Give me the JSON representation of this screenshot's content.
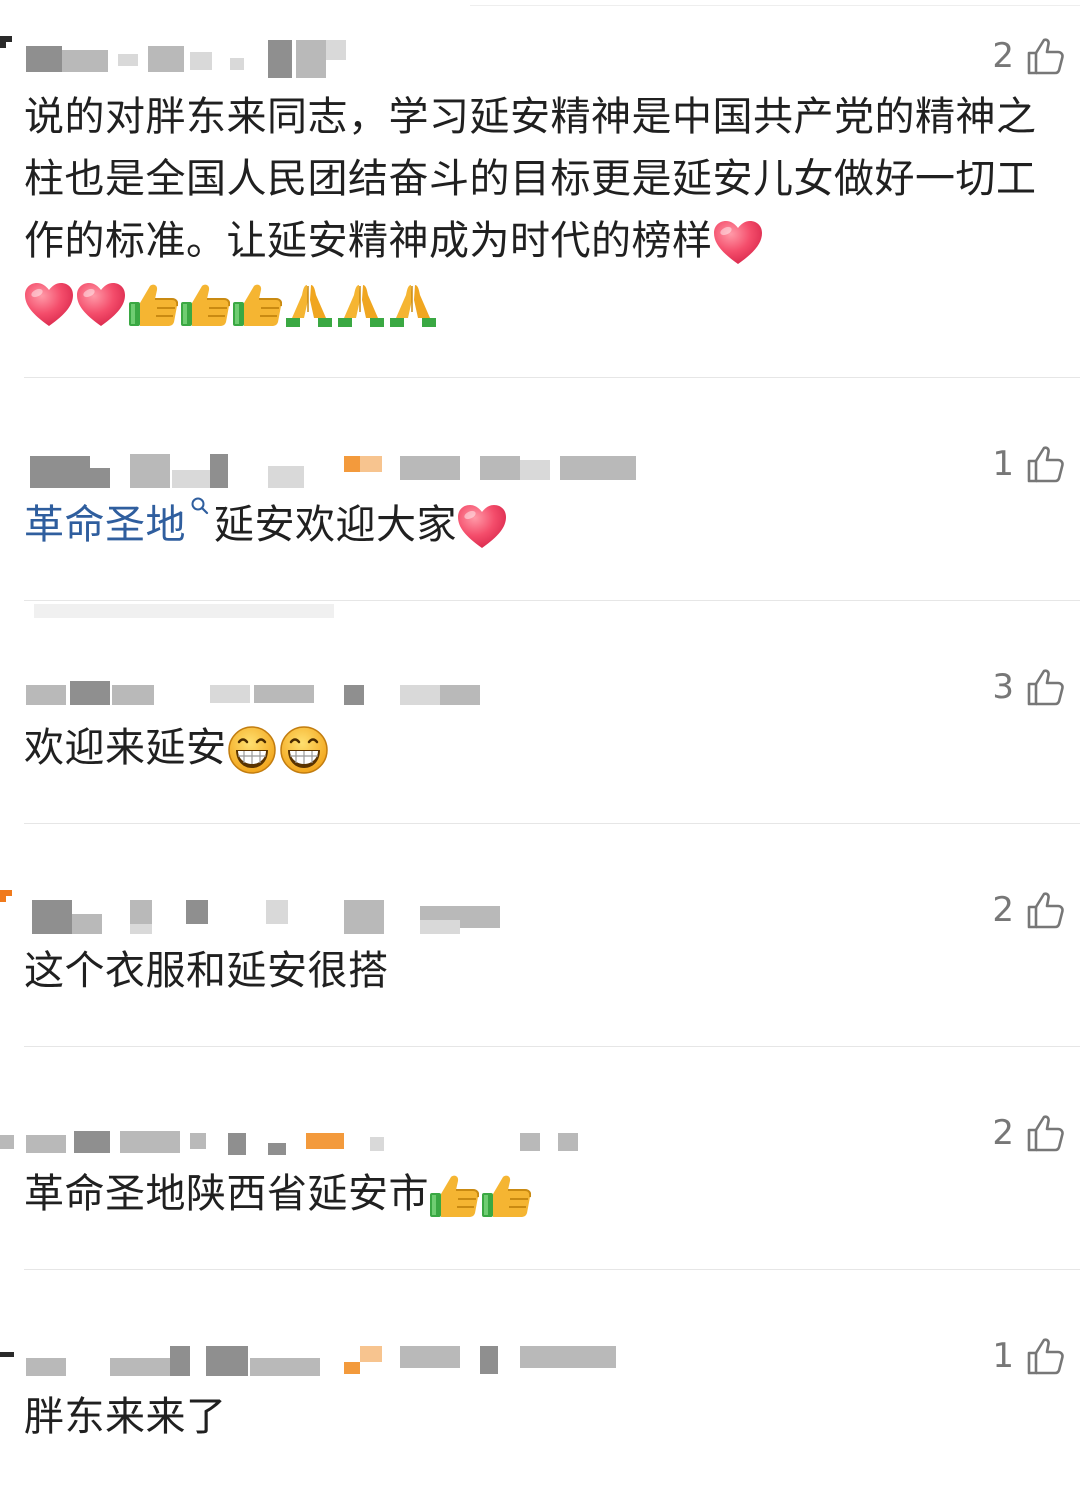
{
  "comments": [
    {
      "likes": "2",
      "text": "说的对胖东来同志，学习延安精神是中国共产党的精神之柱也是全国人民团结奋斗的目标更是延安儿女做好一切工作的标准。让延安精神成为时代的榜样",
      "emojis": [
        "heart",
        "heart",
        "heart",
        "thumbs-up",
        "thumbs-up",
        "thumbs-up",
        "pray",
        "pray",
        "pray"
      ]
    },
    {
      "likes": "1",
      "link_text": "革命圣地",
      "text": "延安欢迎大家",
      "emojis": [
        "heart"
      ]
    },
    {
      "likes": "3",
      "text": "欢迎来延安",
      "emojis": [
        "grin",
        "grin"
      ]
    },
    {
      "likes": "2",
      "text": "这个衣服和延安很搭",
      "emojis": []
    },
    {
      "likes": "2",
      "text": "革命圣地陕西省延安市",
      "emojis": [
        "thumbs-up",
        "thumbs-up"
      ]
    },
    {
      "likes": "1",
      "text": "胖东来来了",
      "emojis": []
    }
  ],
  "icons": {
    "like": "thumbs-up-outline-icon",
    "search": "search-icon",
    "heart": "heart-emoji",
    "thumbs_up": "thumbs-up-emoji",
    "pray": "folded-hands-emoji",
    "grin": "grinning-face-emoji"
  },
  "colors": {
    "link": "#2f5e9e",
    "text": "#202020",
    "like_count": "#777777",
    "divider": "#e6e6e6"
  }
}
